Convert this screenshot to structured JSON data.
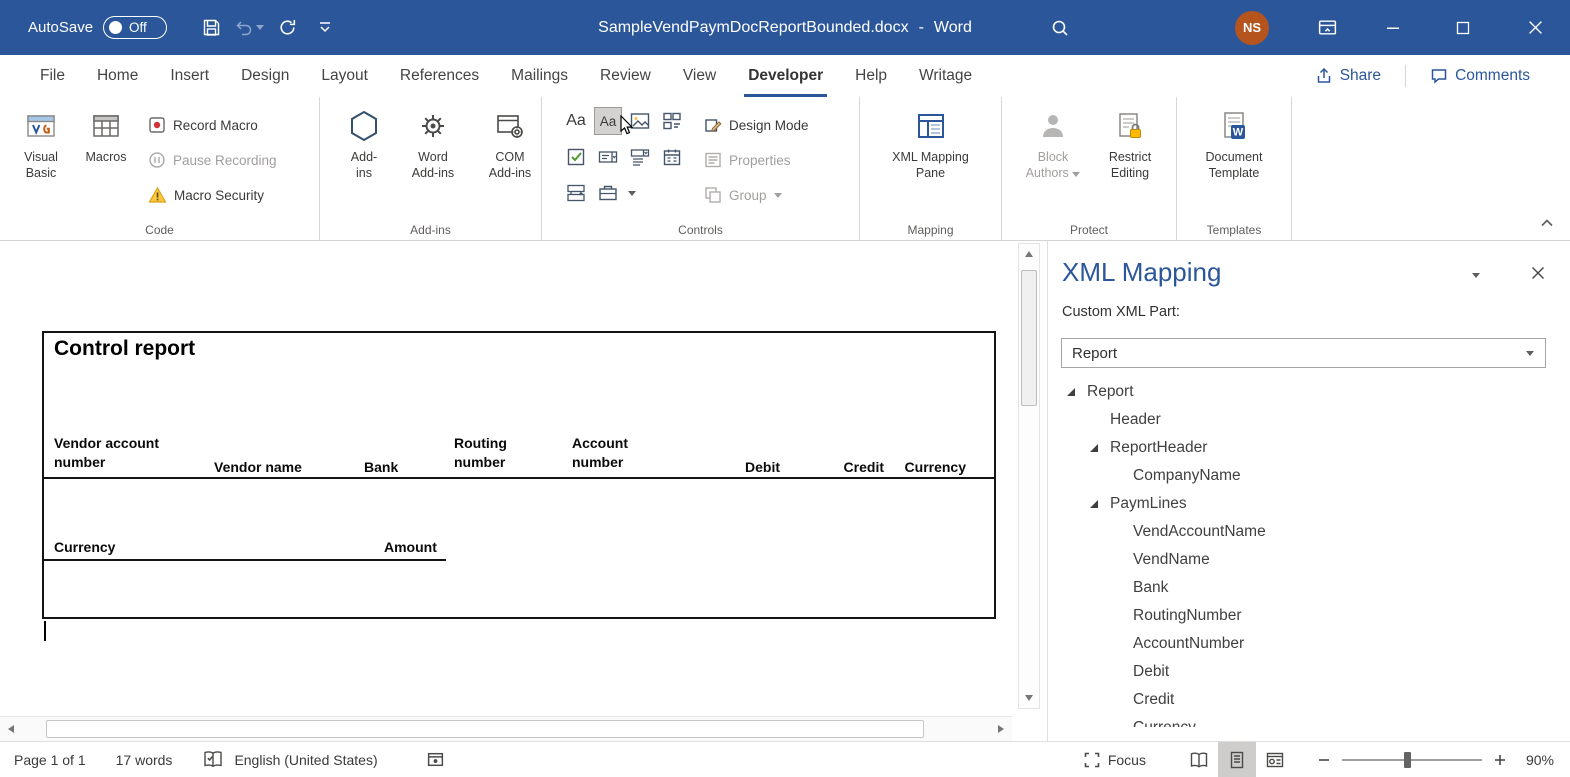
{
  "titlebar": {
    "autosave_label": "AutoSave",
    "autosave_state": "Off",
    "document_title": "SampleVendPaymDocReportBounded.docx",
    "separator": "-",
    "app_name": "Word",
    "avatar_initials": "NS"
  },
  "tabs_row": {
    "tabs": [
      "File",
      "Home",
      "Insert",
      "Design",
      "Layout",
      "References",
      "Mailings",
      "Review",
      "View",
      "Developer",
      "Help",
      "Writage"
    ],
    "active_tab": "Developer",
    "share": "Share",
    "comments": "Comments"
  },
  "ribbon": {
    "code": {
      "label": "Code",
      "visual_basic": [
        "Visual",
        "Basic"
      ],
      "macros": "Macros",
      "record_macro": "Record Macro",
      "pause_recording": "Pause Recording",
      "macro_security": "Macro Security"
    },
    "addins": {
      "label": "Add-ins",
      "addins": [
        "Add-",
        "ins"
      ],
      "word_addins": [
        "Word",
        "Add-ins"
      ],
      "com_addins": [
        "COM",
        "Add-ins"
      ]
    },
    "controls": {
      "label": "Controls",
      "rich_text": "Aa",
      "plain_text": "Aa",
      "design_mode": "Design Mode",
      "properties": "Properties",
      "group": "Group"
    },
    "mapping": {
      "label": "Mapping",
      "xml_mapping_pane": [
        "XML Mapping",
        "Pane"
      ]
    },
    "protect": {
      "label": "Protect",
      "block_authors": [
        "Block",
        "Authors"
      ],
      "restrict_editing": [
        "Restrict",
        "Editing"
      ]
    },
    "templates": {
      "label": "Templates",
      "document_template": [
        "Document",
        "Template"
      ]
    }
  },
  "document": {
    "report_title": "Control report",
    "headers": [
      "Vendor account number",
      "Vendor name",
      "Bank",
      "Routing number",
      "Account number",
      "Debit",
      "Credit",
      "Currency"
    ],
    "row2": [
      "Currency",
      "Amount"
    ]
  },
  "xml_pane": {
    "title": "XML Mapping",
    "part_label": "Custom XML Part:",
    "selected_part": "Report",
    "tree": [
      {
        "label": "Report",
        "level": 0,
        "expanded": true
      },
      {
        "label": "Header",
        "level": 1,
        "expandable": false
      },
      {
        "label": "ReportHeader",
        "level": 1,
        "expanded": true
      },
      {
        "label": "CompanyName",
        "level": 2,
        "expandable": false
      },
      {
        "label": "PaymLines",
        "level": 1,
        "expanded": true
      },
      {
        "label": "VendAccountName",
        "level": 2,
        "expandable": false
      },
      {
        "label": "VendName",
        "level": 2,
        "expandable": false
      },
      {
        "label": "Bank",
        "level": 2,
        "expandable": false
      },
      {
        "label": "RoutingNumber",
        "level": 2,
        "expandable": false
      },
      {
        "label": "AccountNumber",
        "level": 2,
        "expandable": false
      },
      {
        "label": "Debit",
        "level": 2,
        "expandable": false
      },
      {
        "label": "Credit",
        "level": 2,
        "expandable": false
      },
      {
        "label": "Currency",
        "level": 2,
        "expandable": false,
        "clipped": true
      }
    ]
  },
  "statusbar": {
    "page_info": "Page 1 of 1",
    "word_count": "17 words",
    "language": "English (United States)",
    "focus": "Focus",
    "zoom": "90%"
  },
  "colors": {
    "titlebar": "#2b579a",
    "accent": "#2b579a",
    "avatar": "#b5541c"
  }
}
